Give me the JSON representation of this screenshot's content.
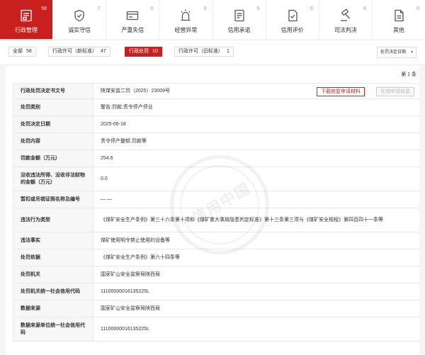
{
  "tabs": [
    {
      "label": "行政管理",
      "count": "58",
      "icon": "admin-icon",
      "active": true
    },
    {
      "label": "诚实守信",
      "count": "7",
      "icon": "trust-shield-icon"
    },
    {
      "label": "严重失信",
      "count": "0",
      "icon": "dishonesty-card-icon"
    },
    {
      "label": "经营异常",
      "count": "0",
      "icon": "alarm-light-icon"
    },
    {
      "label": "信用承诺",
      "count": "5",
      "icon": "commitment-doc-icon"
    },
    {
      "label": "信用评价",
      "count": "0",
      "icon": "evaluation-doc-icon"
    },
    {
      "label": "司法判决",
      "count": "0",
      "icon": "gavel-icon"
    },
    {
      "label": "其他",
      "count": "0",
      "icon": "other-icon"
    }
  ],
  "filters": [
    {
      "label": "全部",
      "count": "58"
    },
    {
      "label": "行政许可（新标准）",
      "count": "47"
    },
    {
      "label": "行政处罚",
      "count": "10",
      "active": true
    },
    {
      "label": "行政许可（旧标准）",
      "count": "1"
    }
  ],
  "sort_select": {
    "value": "处罚决定日期"
  },
  "page_count": "第 1 条",
  "buttons": {
    "download": "下载修复申请材料",
    "online": "在线申请修复"
  },
  "watermark": "信用中国",
  "records": [
    {
      "key": "行政处罚决定书文号",
      "value": "陕煤安监二罚（2025）23009号"
    },
    {
      "key": "处罚类别",
      "value": "警告;罚款;责令停产停业"
    },
    {
      "key": "处罚决定日期",
      "value": "2025-06-18"
    },
    {
      "key": "处罚内容",
      "value": "责令停产整顿,罚款等"
    },
    {
      "key": "罚款金额（万元）",
      "value": "254.6"
    },
    {
      "key": "没收违法所得、没收非法财物的金额（万元）",
      "value": "0.0"
    },
    {
      "key": "暂扣或吊销证照名称及编号",
      "value": "— —"
    },
    {
      "key": "违法行为类型",
      "value": "《煤矿安全生产条例》第三十六条第十项和《煤矿重大事故隐患判定标准》第十三条第三项与《煤矿安全规程》第四百四十一条等"
    },
    {
      "key": "违法事实",
      "value": "煤矿使用明令禁止使用的设备等"
    },
    {
      "key": "处罚依据",
      "value": "《煤矿安全生产条例》第六十四条等"
    },
    {
      "key": "处罚机关",
      "value": "国家矿山安全监察局陕西局"
    },
    {
      "key": "处罚机关统一社会信用代码",
      "value": "11100000016135225L"
    },
    {
      "key": "数据来源",
      "value": "国家矿山安全监察局陕西局"
    },
    {
      "key": "数据来源单位统一社会信用代码",
      "value": "11100000016135225L"
    }
  ],
  "colors": {
    "accent": "#c8201f",
    "key_bg": "#f7f7f7",
    "border": "#e8e8e8"
  }
}
